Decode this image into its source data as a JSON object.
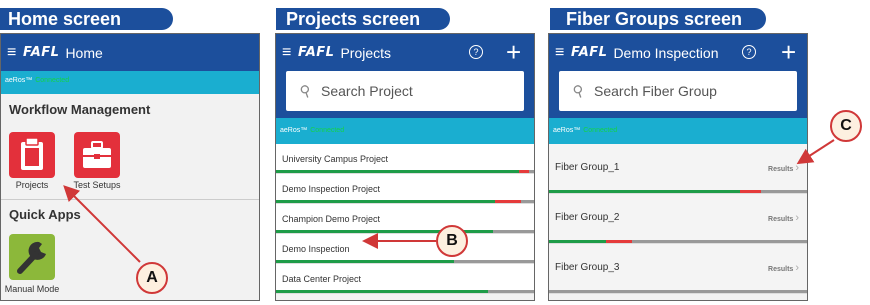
{
  "captions": {
    "home": "Home screen",
    "projects": "Projects screen",
    "fiber": "Fiber Groups screen"
  },
  "app": {
    "logo": "FAFL",
    "status_device": "aeRos™",
    "status_state": "Connected"
  },
  "home": {
    "title": "Home",
    "workflow_header": "Workflow Management",
    "tiles": [
      {
        "label": "Projects",
        "icon": "clipboard-icon"
      },
      {
        "label": "Test Setups",
        "icon": "toolbox-icon"
      }
    ],
    "quick_apps_header": "Quick Apps",
    "quick_apps": [
      {
        "label": "Manual Mode",
        "icon": "wrench-icon"
      }
    ]
  },
  "projects": {
    "title": "Projects",
    "search_placeholder": "Search Project",
    "items": [
      {
        "name": "University Campus Project",
        "green": 0.94,
        "red": 0.04
      },
      {
        "name": "Demo Inspection Project",
        "green": 0.85,
        "red": 0.1
      },
      {
        "name": "Champion Demo Project",
        "green": 0.84,
        "red": 0.0
      },
      {
        "name": "Demo Inspection",
        "green": 0.69,
        "red": 0.0
      },
      {
        "name": "Data Center Project",
        "green": 0.82,
        "red": 0.0
      }
    ]
  },
  "fiber": {
    "title": "Demo Inspection",
    "search_placeholder": "Search Fiber Group",
    "results_label": "Results",
    "groups": [
      {
        "name": "Fiber Group_1",
        "green": 0.74,
        "red": 0.08
      },
      {
        "name": "Fiber Group_2",
        "green": 0.22,
        "red": 0.1
      },
      {
        "name": "Fiber Group_3",
        "green": 0.0,
        "red": 0.0
      }
    ]
  },
  "callouts": {
    "a": "A",
    "b": "B",
    "c": "C"
  },
  "colors": {
    "brand": "#1c4f9c",
    "status_strip": "#1aaed0",
    "pass": "#1e9c48",
    "fail": "#e53b3b",
    "tile_red": "#e3303b",
    "tile_green": "#8cb83a"
  }
}
